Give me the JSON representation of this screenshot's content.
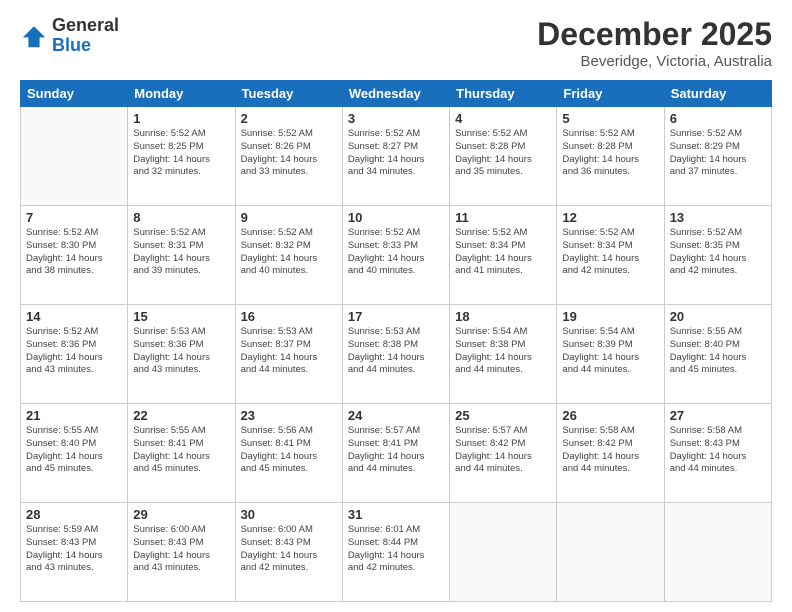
{
  "header": {
    "logo_general": "General",
    "logo_blue": "Blue",
    "main_title": "December 2025",
    "subtitle": "Beveridge, Victoria, Australia"
  },
  "days_of_week": [
    "Sunday",
    "Monday",
    "Tuesday",
    "Wednesday",
    "Thursday",
    "Friday",
    "Saturday"
  ],
  "weeks": [
    [
      {
        "day": "",
        "info": ""
      },
      {
        "day": "1",
        "info": "Sunrise: 5:52 AM\nSunset: 8:25 PM\nDaylight: 14 hours\nand 32 minutes."
      },
      {
        "day": "2",
        "info": "Sunrise: 5:52 AM\nSunset: 8:26 PM\nDaylight: 14 hours\nand 33 minutes."
      },
      {
        "day": "3",
        "info": "Sunrise: 5:52 AM\nSunset: 8:27 PM\nDaylight: 14 hours\nand 34 minutes."
      },
      {
        "day": "4",
        "info": "Sunrise: 5:52 AM\nSunset: 8:28 PM\nDaylight: 14 hours\nand 35 minutes."
      },
      {
        "day": "5",
        "info": "Sunrise: 5:52 AM\nSunset: 8:28 PM\nDaylight: 14 hours\nand 36 minutes."
      },
      {
        "day": "6",
        "info": "Sunrise: 5:52 AM\nSunset: 8:29 PM\nDaylight: 14 hours\nand 37 minutes."
      }
    ],
    [
      {
        "day": "7",
        "info": "Sunrise: 5:52 AM\nSunset: 8:30 PM\nDaylight: 14 hours\nand 38 minutes."
      },
      {
        "day": "8",
        "info": "Sunrise: 5:52 AM\nSunset: 8:31 PM\nDaylight: 14 hours\nand 39 minutes."
      },
      {
        "day": "9",
        "info": "Sunrise: 5:52 AM\nSunset: 8:32 PM\nDaylight: 14 hours\nand 40 minutes."
      },
      {
        "day": "10",
        "info": "Sunrise: 5:52 AM\nSunset: 8:33 PM\nDaylight: 14 hours\nand 40 minutes."
      },
      {
        "day": "11",
        "info": "Sunrise: 5:52 AM\nSunset: 8:34 PM\nDaylight: 14 hours\nand 41 minutes."
      },
      {
        "day": "12",
        "info": "Sunrise: 5:52 AM\nSunset: 8:34 PM\nDaylight: 14 hours\nand 42 minutes."
      },
      {
        "day": "13",
        "info": "Sunrise: 5:52 AM\nSunset: 8:35 PM\nDaylight: 14 hours\nand 42 minutes."
      }
    ],
    [
      {
        "day": "14",
        "info": "Sunrise: 5:52 AM\nSunset: 8:36 PM\nDaylight: 14 hours\nand 43 minutes."
      },
      {
        "day": "15",
        "info": "Sunrise: 5:53 AM\nSunset: 8:36 PM\nDaylight: 14 hours\nand 43 minutes."
      },
      {
        "day": "16",
        "info": "Sunrise: 5:53 AM\nSunset: 8:37 PM\nDaylight: 14 hours\nand 44 minutes."
      },
      {
        "day": "17",
        "info": "Sunrise: 5:53 AM\nSunset: 8:38 PM\nDaylight: 14 hours\nand 44 minutes."
      },
      {
        "day": "18",
        "info": "Sunrise: 5:54 AM\nSunset: 8:38 PM\nDaylight: 14 hours\nand 44 minutes."
      },
      {
        "day": "19",
        "info": "Sunrise: 5:54 AM\nSunset: 8:39 PM\nDaylight: 14 hours\nand 44 minutes."
      },
      {
        "day": "20",
        "info": "Sunrise: 5:55 AM\nSunset: 8:40 PM\nDaylight: 14 hours\nand 45 minutes."
      }
    ],
    [
      {
        "day": "21",
        "info": "Sunrise: 5:55 AM\nSunset: 8:40 PM\nDaylight: 14 hours\nand 45 minutes."
      },
      {
        "day": "22",
        "info": "Sunrise: 5:55 AM\nSunset: 8:41 PM\nDaylight: 14 hours\nand 45 minutes."
      },
      {
        "day": "23",
        "info": "Sunrise: 5:56 AM\nSunset: 8:41 PM\nDaylight: 14 hours\nand 45 minutes."
      },
      {
        "day": "24",
        "info": "Sunrise: 5:57 AM\nSunset: 8:41 PM\nDaylight: 14 hours\nand 44 minutes."
      },
      {
        "day": "25",
        "info": "Sunrise: 5:57 AM\nSunset: 8:42 PM\nDaylight: 14 hours\nand 44 minutes."
      },
      {
        "day": "26",
        "info": "Sunrise: 5:58 AM\nSunset: 8:42 PM\nDaylight: 14 hours\nand 44 minutes."
      },
      {
        "day": "27",
        "info": "Sunrise: 5:58 AM\nSunset: 8:43 PM\nDaylight: 14 hours\nand 44 minutes."
      }
    ],
    [
      {
        "day": "28",
        "info": "Sunrise: 5:59 AM\nSunset: 8:43 PM\nDaylight: 14 hours\nand 43 minutes."
      },
      {
        "day": "29",
        "info": "Sunrise: 6:00 AM\nSunset: 8:43 PM\nDaylight: 14 hours\nand 43 minutes."
      },
      {
        "day": "30",
        "info": "Sunrise: 6:00 AM\nSunset: 8:43 PM\nDaylight: 14 hours\nand 42 minutes."
      },
      {
        "day": "31",
        "info": "Sunrise: 6:01 AM\nSunset: 8:44 PM\nDaylight: 14 hours\nand 42 minutes."
      },
      {
        "day": "",
        "info": ""
      },
      {
        "day": "",
        "info": ""
      },
      {
        "day": "",
        "info": ""
      }
    ]
  ]
}
